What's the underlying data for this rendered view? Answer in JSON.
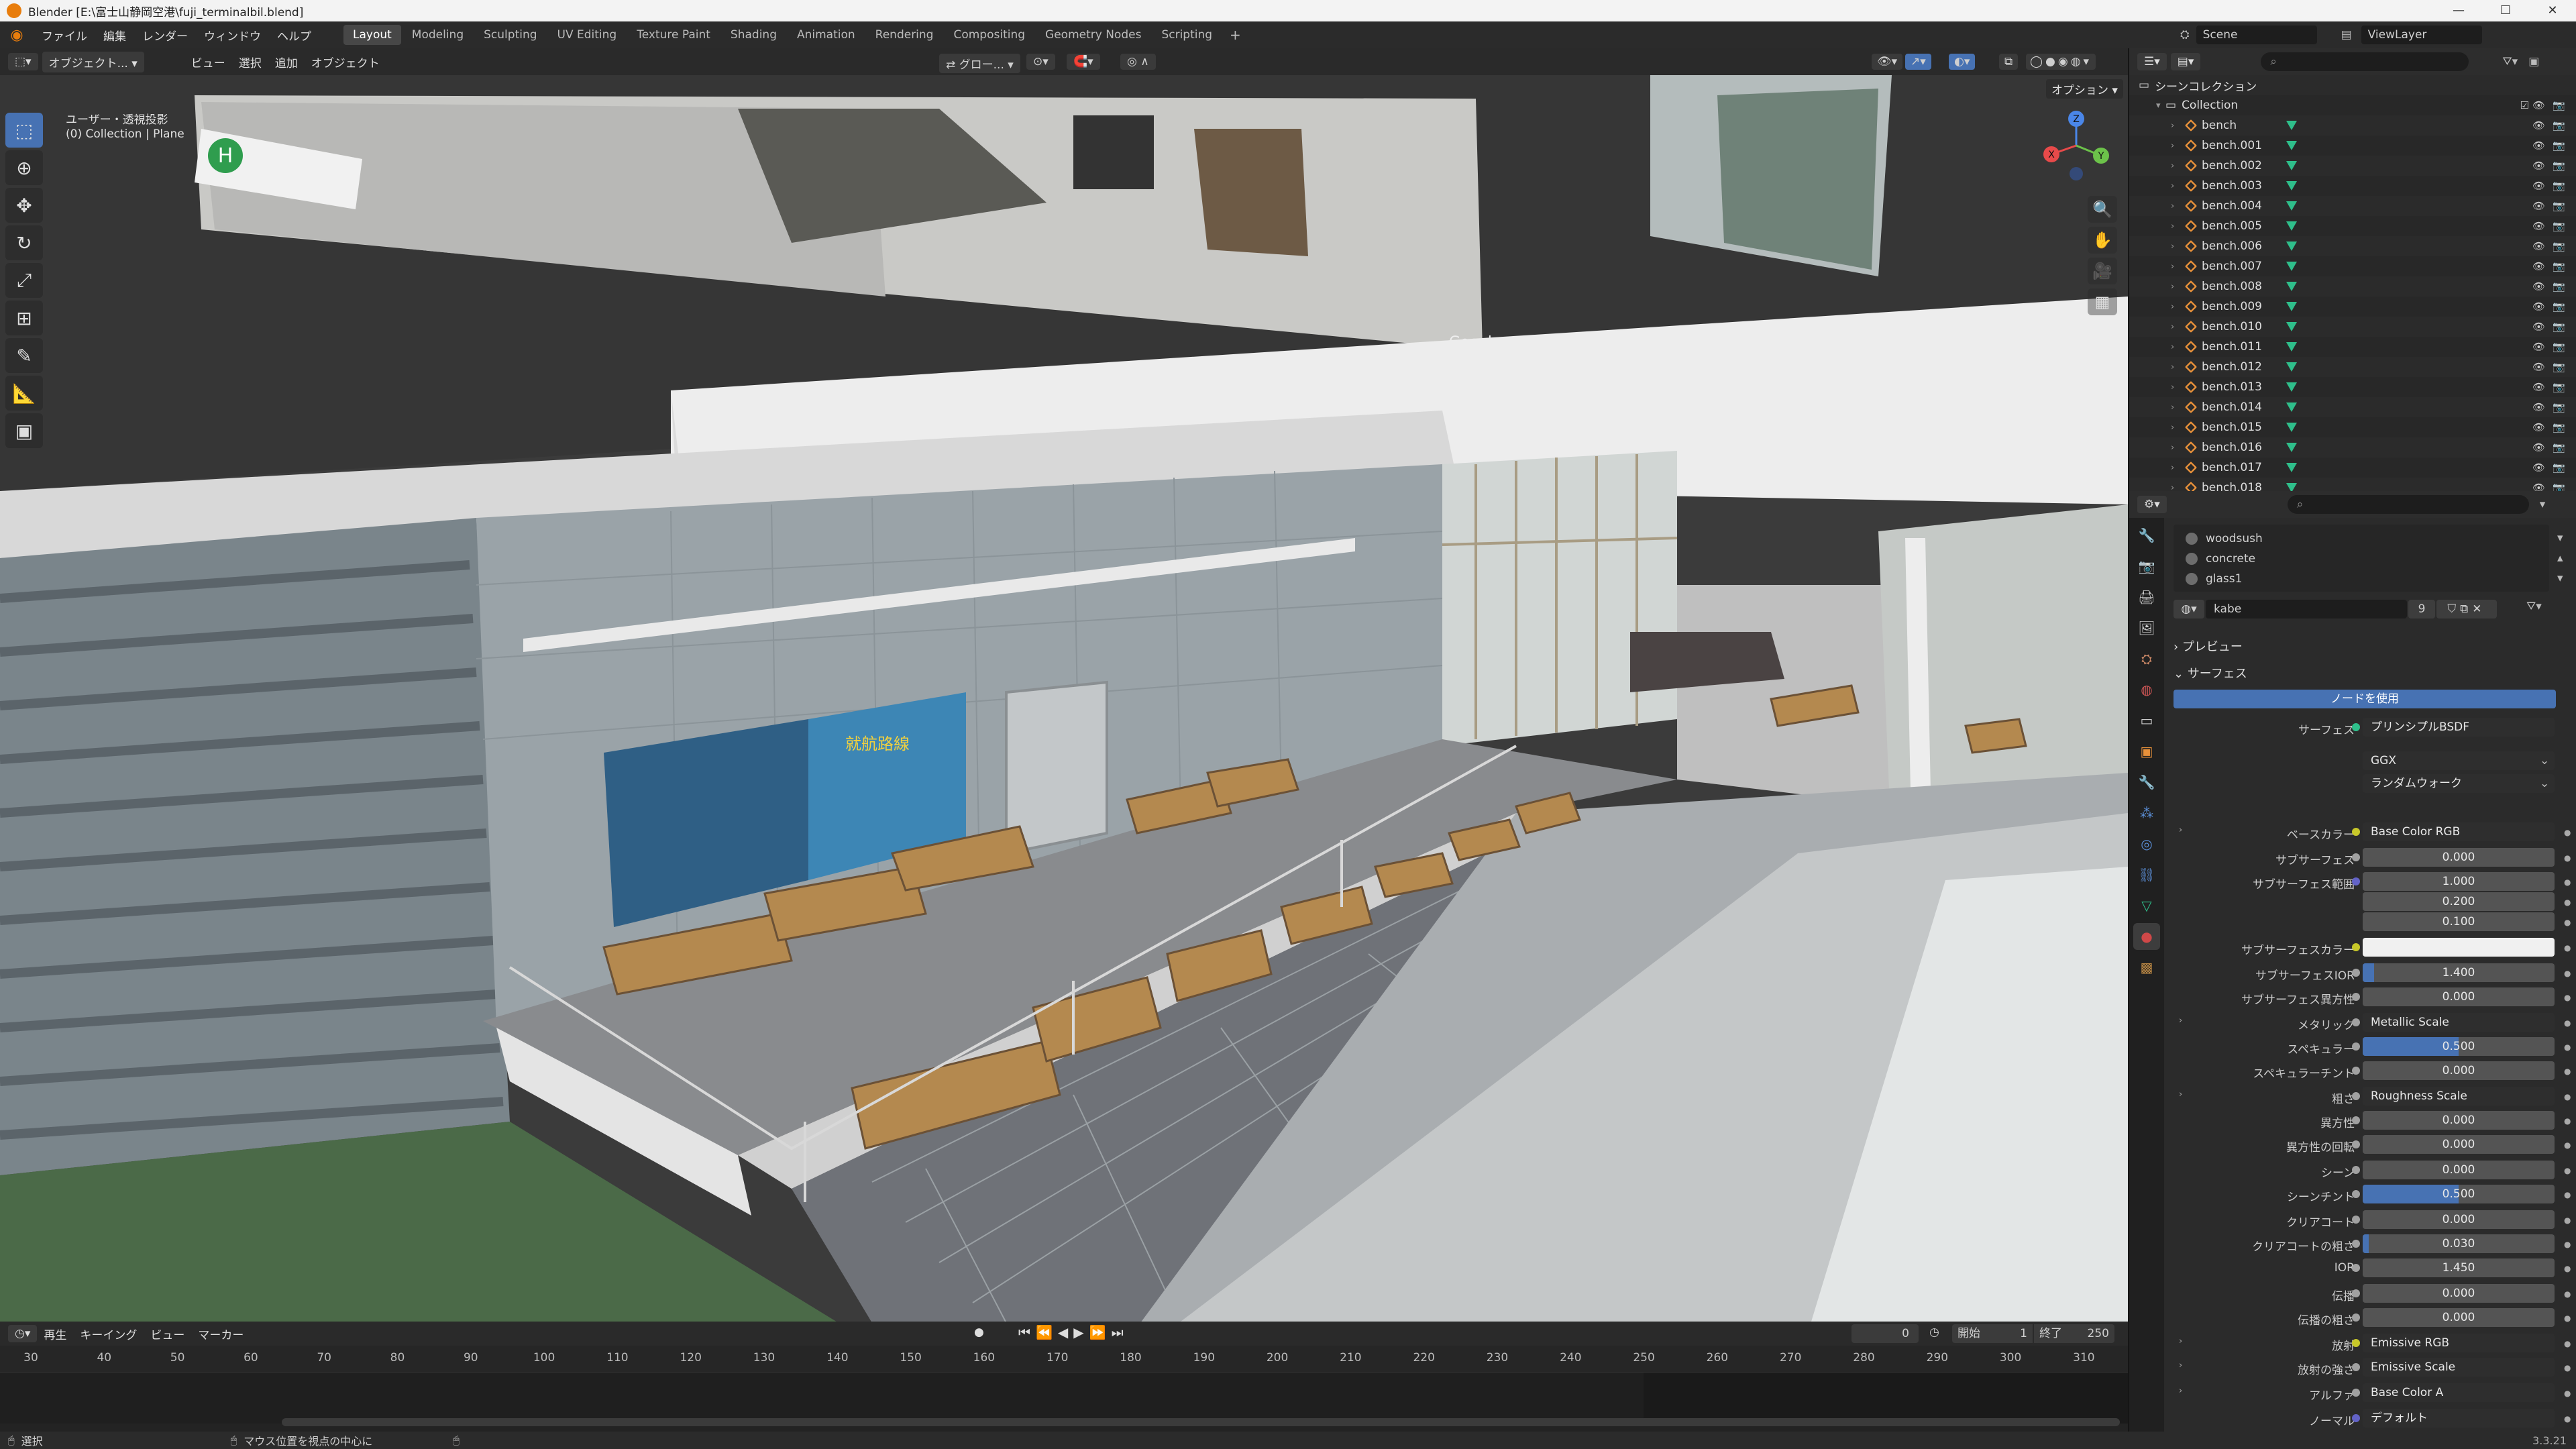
{
  "window": {
    "title": "Blender [E:\\富士山静岡空港\\fuji_terminalbil.blend]",
    "minimize": "—",
    "maximize": "☐",
    "close": "✕"
  },
  "menu": [
    "ファイル",
    "編集",
    "レンダー",
    "ウィンドウ",
    "ヘルプ"
  ],
  "workspaces": [
    {
      "label": "Layout",
      "active": true
    },
    {
      "label": "Modeling"
    },
    {
      "label": "Sculpting"
    },
    {
      "label": "UV Editing"
    },
    {
      "label": "Texture Paint"
    },
    {
      "label": "Shading"
    },
    {
      "label": "Animation"
    },
    {
      "label": "Rendering"
    },
    {
      "label": "Compositing"
    },
    {
      "label": "Geometry Nodes"
    },
    {
      "label": "Scripting"
    }
  ],
  "scene": {
    "name": "Scene",
    "view_layer": "ViewLayer"
  },
  "viewport_header": {
    "mode": "オブジェクト...",
    "menus": [
      "ビュー",
      "選択",
      "追加",
      "オブジェクト"
    ],
    "transform": "グロー...",
    "options": "オプション"
  },
  "viewport_info": {
    "line1": "ユーザー・透視投影",
    "line2": "(0) Collection | Plane"
  },
  "gizmo_axes": {
    "x": "X",
    "y": "Y",
    "z": "Z"
  },
  "outliner": {
    "root": "シーンコレクション",
    "collection": "Collection",
    "objects": [
      "bench",
      "bench.001",
      "bench.002",
      "bench.003",
      "bench.004",
      "bench.005",
      "bench.006",
      "bench.007",
      "bench.008",
      "bench.009",
      "bench.010",
      "bench.011",
      "bench.012",
      "bench.013",
      "bench.014",
      "bench.015",
      "bench.016",
      "bench.017",
      "bench.018"
    ]
  },
  "properties": {
    "material_slots": [
      "woodsush",
      "concrete",
      "glass1"
    ],
    "material_name": "kabe",
    "user_count": "9",
    "sections": {
      "preview": "プレビュー",
      "surface": "サーフェス"
    },
    "use_nodes_button": "ノードを使用",
    "surface_label": "サーフェス",
    "surface_value": "プリンシプルBSDF",
    "distribution": "GGX",
    "subsurface_method": "ランダムウォーク",
    "rows": [
      {
        "label": "ベースカラー",
        "value": "Base Color RGB",
        "link": true,
        "sock": "#c7c729",
        "exp": true
      },
      {
        "label": "サブサーフェス",
        "value": "0.000",
        "sock": "#a1a1a1"
      },
      {
        "label": "サブサーフェス範囲",
        "value": "1.000",
        "sock": "#6363c7"
      },
      {
        "label": "",
        "value": "0.200"
      },
      {
        "label": "",
        "value": "0.100"
      },
      {
        "label": "サブサーフェスカラー",
        "value": "",
        "color": "#f0f0f0",
        "sock": "#c7c729"
      },
      {
        "label": "サブサーフェスIOR",
        "value": "1.400",
        "fill": 0.06,
        "sock": "#a1a1a1"
      },
      {
        "label": "サブサーフェス異方性",
        "value": "0.000",
        "sock": "#a1a1a1"
      },
      {
        "label": "メタリック",
        "value": "Metallic Scale",
        "link": true,
        "sock": "#a1a1a1",
        "exp": true
      },
      {
        "label": "スペキュラー",
        "value": "0.500",
        "fill": 0.5,
        "sock": "#a1a1a1"
      },
      {
        "label": "スペキュラーチント",
        "value": "0.000",
        "sock": "#a1a1a1"
      },
      {
        "label": "粗さ",
        "value": "Roughness Scale",
        "link": true,
        "sock": "#a1a1a1",
        "exp": true
      },
      {
        "label": "異方性",
        "value": "0.000",
        "sock": "#a1a1a1"
      },
      {
        "label": "異方性の回転",
        "value": "0.000",
        "sock": "#a1a1a1"
      },
      {
        "label": "シーン",
        "value": "0.000",
        "sock": "#a1a1a1"
      },
      {
        "label": "シーンチント",
        "value": "0.500",
        "fill": 0.5,
        "sock": "#a1a1a1"
      },
      {
        "label": "クリアコート",
        "value": "0.000",
        "sock": "#a1a1a1"
      },
      {
        "label": "クリアコートの粗さ",
        "value": "0.030",
        "fill": 0.03,
        "sock": "#a1a1a1"
      },
      {
        "label": "IOR",
        "value": "1.450",
        "sock": "#a1a1a1"
      },
      {
        "label": "伝播",
        "value": "0.000",
        "sock": "#a1a1a1"
      },
      {
        "label": "伝播の粗さ",
        "value": "0.000",
        "sock": "#a1a1a1"
      },
      {
        "label": "放射",
        "value": "Emissive RGB",
        "link": true,
        "sock": "#c7c729",
        "exp": true
      },
      {
        "label": "放射の強さ",
        "value": "Emissive Scale",
        "link": true,
        "sock": "#a1a1a1",
        "exp": true
      },
      {
        "label": "アルファ",
        "value": "Base Color A",
        "link": true,
        "sock": "#a1a1a1",
        "exp": true
      },
      {
        "label": "ノーマル",
        "value": "デフォルト",
        "link": true,
        "sock": "#6363c7"
      }
    ]
  },
  "timeline": {
    "menus": [
      "再生",
      "キーイング",
      "ビュー",
      "マーカー"
    ],
    "current_frame": "0",
    "start_label": "開始",
    "start": "1",
    "end_label": "終了",
    "end": "250",
    "ticks": [
      "30",
      "40",
      "50",
      "60",
      "70",
      "80",
      "90",
      "100",
      "110",
      "120",
      "130",
      "140",
      "150",
      "160",
      "170",
      "180",
      "190",
      "200",
      "210",
      "220",
      "230",
      "240",
      "250",
      "260",
      "270",
      "280",
      "290",
      "300",
      "310"
    ]
  },
  "statusbar": {
    "left": "選択",
    "middle": "マウス位置を視点の中心に",
    "version": "3.3.21"
  },
  "scene_text": {
    "map_title": "就航路線",
    "sign": "H",
    "watermark": "Google"
  }
}
